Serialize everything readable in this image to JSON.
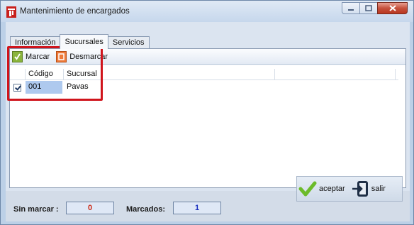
{
  "window": {
    "title": "Mantenimiento de encargados",
    "icon": "red-app-icon",
    "controls": [
      "minimize-icon",
      "maximize-icon",
      "close-icon"
    ]
  },
  "tabs": [
    {
      "label": "Información",
      "active": false
    },
    {
      "label": "Sucursales",
      "active": true
    },
    {
      "label": "Servicios",
      "active": false
    }
  ],
  "toolbar": {
    "mark_label": "Marcar",
    "unmark_label": "Desmarcar"
  },
  "grid": {
    "columns": [
      "Código",
      "Sucursal"
    ],
    "rows": [
      {
        "checked": true,
        "codigo": "001",
        "sucursal": "Pavas"
      }
    ]
  },
  "status": {
    "unmarked_label": "Sin marcar :",
    "unmarked_count": "0",
    "marked_label": "Marcados:",
    "marked_count": "1"
  },
  "actions": {
    "accept_label": "aceptar",
    "exit_label": "salir"
  },
  "colors": {
    "highlight": "#d0141c",
    "unmarked_value": "#cc2b17",
    "marked_value": "#1a2fbf"
  }
}
